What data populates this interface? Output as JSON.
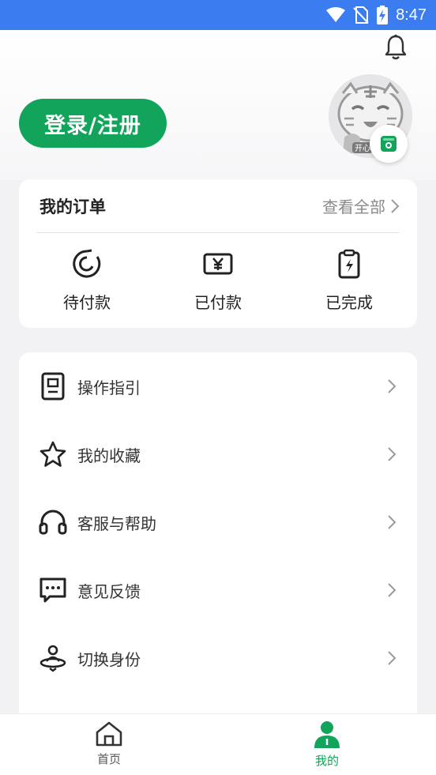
{
  "status_bar": {
    "time": "8:47"
  },
  "header": {
    "login_label": "登录/注册",
    "avatar_badge": "开心"
  },
  "orders": {
    "title": "我的订单",
    "view_all": "查看全部",
    "items": [
      {
        "label": "待付款",
        "icon": "pending-payment-icon"
      },
      {
        "label": "已付款",
        "icon": "paid-yen-icon"
      },
      {
        "label": "已完成",
        "icon": "completed-clipboard-icon"
      }
    ]
  },
  "menu": {
    "items": [
      {
        "label": "操作指引",
        "icon": "guide-document-icon"
      },
      {
        "label": "我的收藏",
        "icon": "star-icon"
      },
      {
        "label": "客服与帮助",
        "icon": "headset-icon"
      },
      {
        "label": "意见反馈",
        "icon": "feedback-chat-icon"
      },
      {
        "label": "切换身份",
        "icon": "switch-identity-icon"
      }
    ]
  },
  "tabbar": {
    "tabs": [
      {
        "label": "首页",
        "icon": "home-icon",
        "active": false
      },
      {
        "label": "我的",
        "icon": "profile-icon",
        "active": true
      }
    ]
  },
  "colors": {
    "accent": "#11a45a",
    "status_bar": "#3b7df0",
    "background": "#f2f2f4"
  }
}
